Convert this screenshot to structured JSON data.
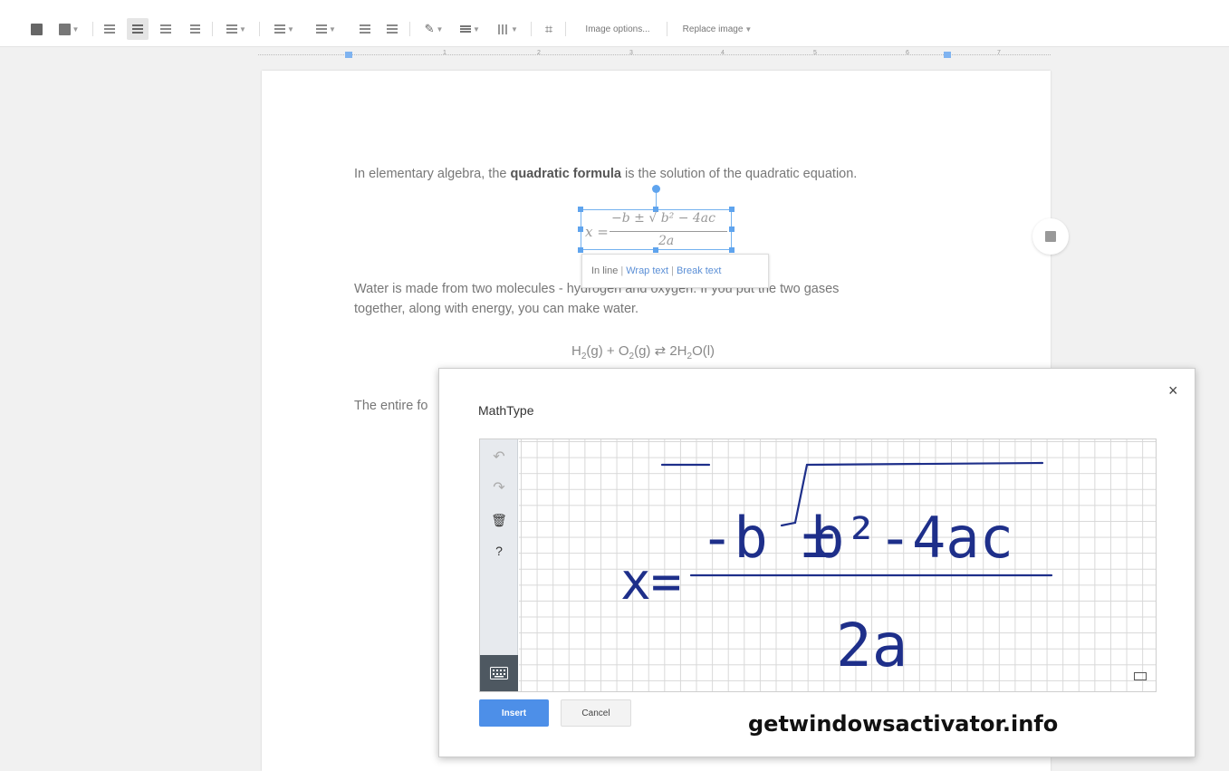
{
  "toolbar": {
    "image_options_label": "Image options...",
    "replace_image_label": "Replace image",
    "icons": [
      "insert-image-icon",
      "image-icon",
      "align-left-icon",
      "align-center-icon",
      "align-right-icon",
      "justify-icon",
      "line-spacing-icon",
      "numbered-list-icon",
      "bulleted-list-icon",
      "decrease-indent-icon",
      "increase-indent-icon",
      "border-color-icon",
      "border-weight-icon",
      "border-dash-icon",
      "crop-icon"
    ]
  },
  "ruler": {
    "numbers": [
      "1",
      "2",
      "3",
      "4",
      "5",
      "6",
      "7"
    ]
  },
  "document": {
    "para1_before": "In elementary algebra, the ",
    "para1_bold": "quadratic formula",
    "para1_after": " is the solution of the quadratic equation.",
    "equation": {
      "lhs": "x =",
      "numerator": "−b ± √ b² − 4ac",
      "denominator": "2a"
    },
    "wrap_options": {
      "inline": "In line",
      "wrap": "Wrap text",
      "break": "Break text"
    },
    "para2_line1": "Water is made from two molecules - hydrogen and oxygen. If you put the two gases",
    "para2_line2": "together, along with energy, you can make water.",
    "chem_parts": {
      "h": "H",
      "h_sub": "2",
      "g1": "(g) + O",
      "o_sub": "2",
      "g2": "(g) ⇄ 2H",
      "h2_sub": "2",
      "tail": "O(l)"
    },
    "para3": "The entire fo"
  },
  "mathtype": {
    "title": "MathType",
    "close_label": "×",
    "handwriting": {
      "lhs": "x=",
      "numerator": "-b ±",
      "radicand": "b²-4ac",
      "denominator": "2a"
    },
    "insert_label": "Insert",
    "cancel_label": "Cancel",
    "side_icons": [
      "undo-icon",
      "redo-icon",
      "trash-icon",
      "help-icon",
      "keyboard-icon"
    ]
  },
  "watermark": "getwindowsactivator.info"
}
